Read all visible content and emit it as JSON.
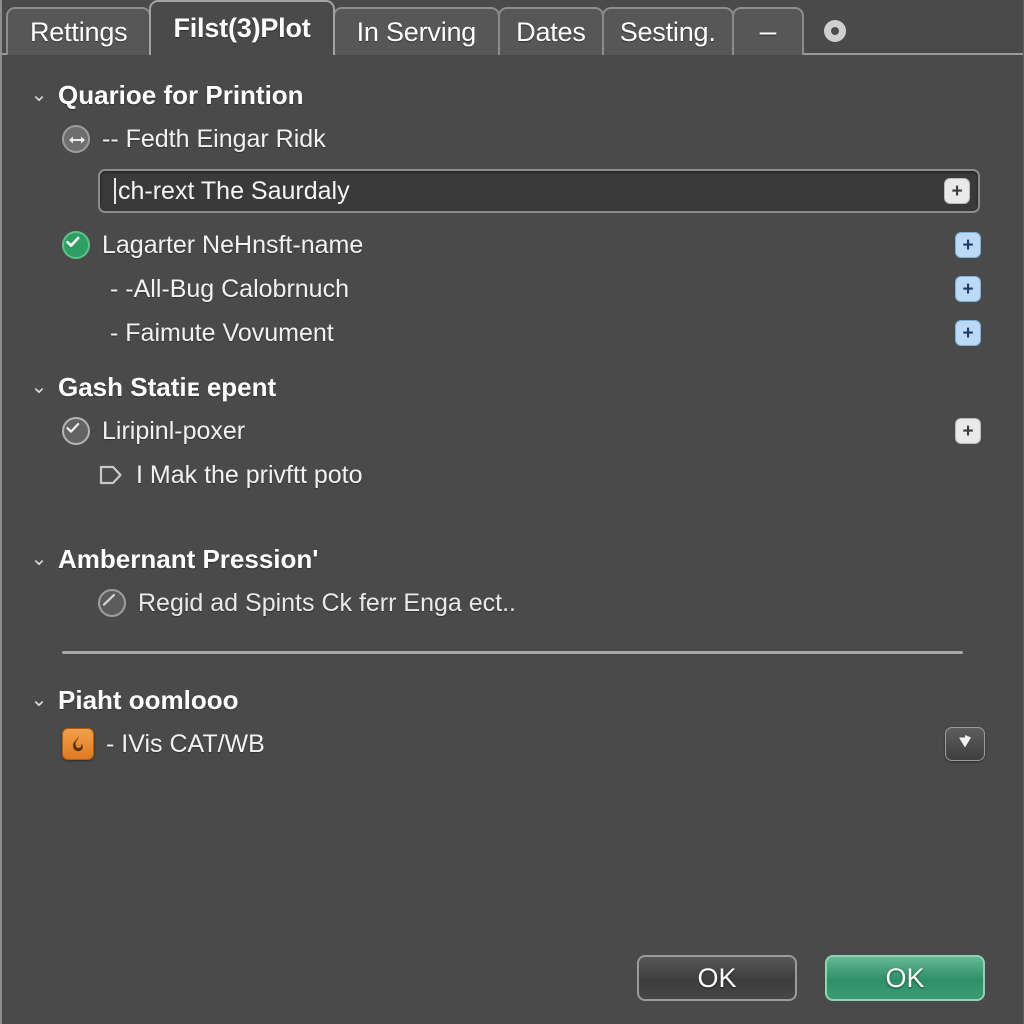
{
  "window": {
    "tabs": [
      {
        "label": "Rettings",
        "active": false,
        "kind": "text"
      },
      {
        "label": "Filst(3)Plot",
        "active": true,
        "kind": "text"
      },
      {
        "label": "In Serving",
        "active": false,
        "kind": "text"
      },
      {
        "label": "Dates",
        "active": false,
        "kind": "text"
      },
      {
        "label": "Sesting.",
        "active": false,
        "kind": "text"
      },
      {
        "label": "–",
        "active": false,
        "kind": "minimize"
      },
      {
        "label": "",
        "active": false,
        "kind": "record"
      }
    ]
  },
  "sections": {
    "printion": {
      "title": "Quarioe for Printion",
      "chevron": "⌄",
      "resize_item": {
        "icon": "resize-arrows-icon",
        "label": "-- Fedth Eingar Ridk"
      },
      "input": {
        "value": "ch-rext The Saurdaly",
        "placeholder": "ch-rext The Saurdaly",
        "add_label": "+"
      },
      "checked_item": {
        "icon": "check-circle-green-icon",
        "label": "Lagarter NeHnsft-name",
        "add_label": "+"
      },
      "sub_items": [
        {
          "label": "- -All-Bug Calobrnuch",
          "add_label": "+"
        },
        {
          "label": "- Faimute Vovument",
          "add_label": "+"
        }
      ]
    },
    "gash": {
      "title": "Gash Statiᴇ epent",
      "chevron": "⌄",
      "checked_item": {
        "icon": "check-circle-gray-icon",
        "label": "Liripinl-poxer",
        "add_label": "+"
      },
      "tag_item": {
        "icon": "tag-outline-icon",
        "label": "I Mak the privftt poto"
      }
    },
    "ambernant": {
      "title": "Ambernant Pression'",
      "chevron": "⌄",
      "banned_item": {
        "icon": "no-entry-circle-icon",
        "label": "Regid ad Spints Ck ferr Enga ect.."
      }
    },
    "piaht": {
      "title": "Piaht oomlooo",
      "chevron": "⌄",
      "app_item": {
        "icon": "orange-app-icon",
        "label": "- IVis CAT/WB",
        "menu_icon": "chevron-down-icon"
      }
    }
  },
  "footer": {
    "secondary_label": "OK",
    "primary_label": "OK"
  },
  "colors": {
    "panel_bg": "#4a4a4a",
    "tab_bg": "#575757",
    "accent_green": "#2f8f68",
    "accent_blue": "#bcd9f5",
    "accent_orange": "#e07a24",
    "check_green": "#2f9e63"
  }
}
